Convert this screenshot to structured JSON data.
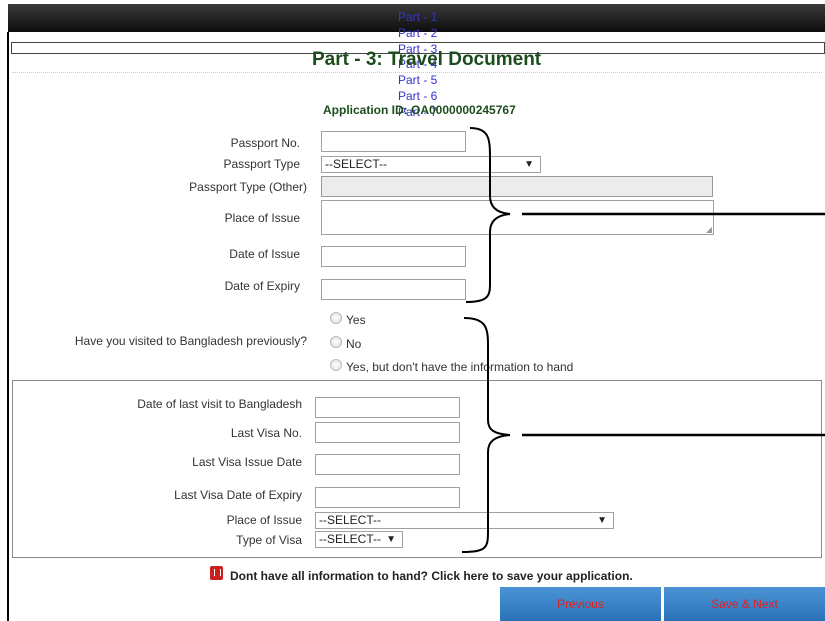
{
  "nav": {
    "parts": [
      "Part - 1",
      "Part - 2",
      "Part - 3",
      "Part - 4",
      "Part - 5",
      "Part - 6",
      "Part - 7"
    ]
  },
  "page": {
    "title": "Part - 3: Travel Document",
    "application_id": "Application ID: OA0000000245767"
  },
  "form": {
    "passport_no_label": "Passport No.",
    "passport_no_value": "",
    "passport_type_label": "Passport Type",
    "passport_type_value": "--SELECT--",
    "passport_type_other_label": "Passport Type (Other)",
    "place_of_issue_label": "Place of Issue",
    "date_of_issue_label": "Date of Issue",
    "date_of_expiry_label": "Date of Expiry",
    "visited_question": "Have you visited to Bangladesh previously?",
    "visited_options": [
      "Yes",
      "No",
      "Yes, but don't have the information to hand"
    ]
  },
  "previous_visit": {
    "date_last_visit_label": "Date of last visit to Bangladesh",
    "last_visa_no_label": "Last Visa No.",
    "last_visa_issue_date_label": "Last Visa Issue Date",
    "last_visa_expiry_label": "Last Visa Date of Expiry",
    "place_of_issue_label": "Place of Issue",
    "place_of_issue_value": "--SELECT--",
    "type_of_visa_label": "Type of Visa",
    "type_of_visa_value": "--SELECT--"
  },
  "footer": {
    "save_text": "Dont have all information to hand? Click here to save your application.",
    "previous_label": "Previous",
    "save_next_label": "Save & Next"
  }
}
